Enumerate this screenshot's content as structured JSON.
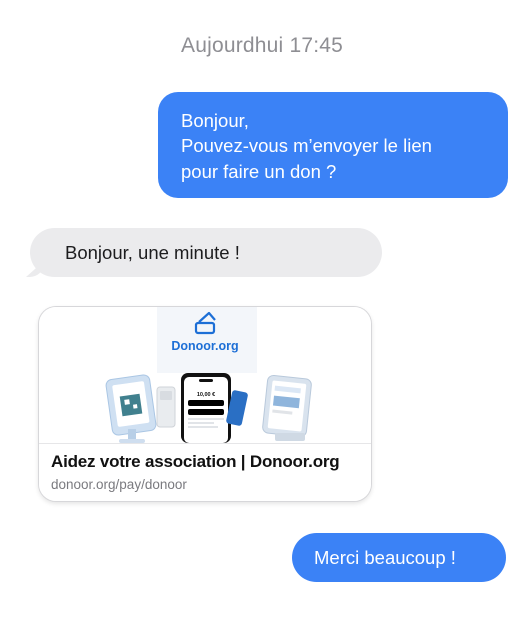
{
  "conversation": {
    "timestamp": "Aujourdhui 17:45",
    "messages": [
      {
        "direction": "outgoing",
        "lines": [
          "Bonjour,",
          "Pouvez-vous m’envoyer le lien",
          "pour faire un don ?"
        ]
      },
      {
        "direction": "incoming",
        "text": "Bonjour, une minute !"
      },
      {
        "direction": "incoming",
        "type": "link-preview",
        "brand": "Donoor.org",
        "phone_amount": "10,00 €",
        "title": "Aidez votre association | Donoor.org",
        "url": "donoor.org/pay/donoor"
      },
      {
        "direction": "outgoing",
        "text": "Merci beaucoup !"
      }
    ]
  },
  "colors": {
    "outgoing_bubble": "#3b82f6",
    "incoming_bubble": "#ebebed",
    "timestamp": "#8e8e93",
    "brand": "#1d6fd6"
  }
}
